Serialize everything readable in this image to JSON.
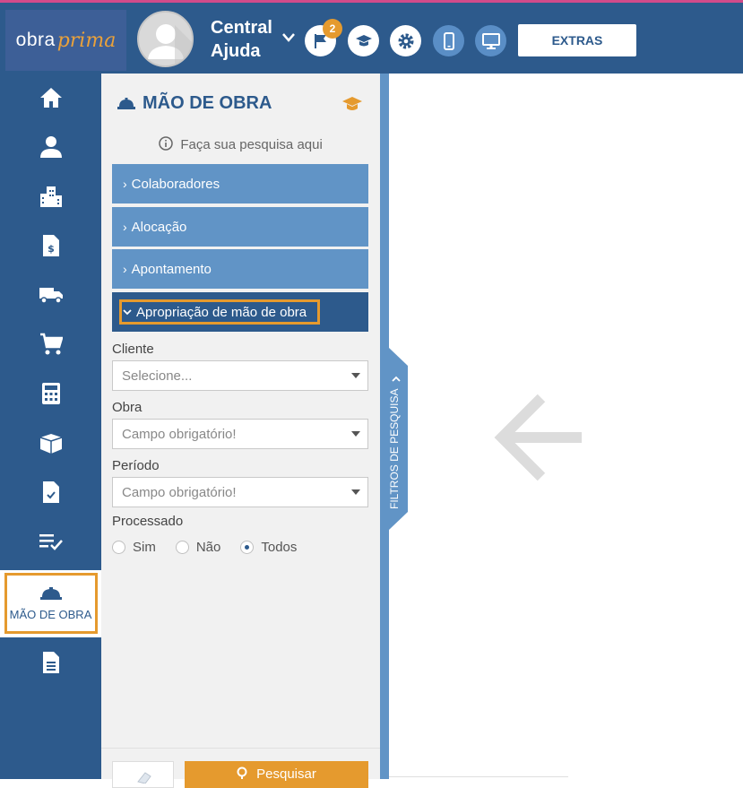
{
  "brand": {
    "logo_part1": "obra",
    "logo_part2": "prima"
  },
  "header": {
    "user_name_line1": "Central",
    "user_name_line2": "Ajuda",
    "notification_count": "2",
    "extras_label": "EXTRAS",
    "icons": [
      "flag-icon",
      "graduation-cap-icon",
      "gear-icon",
      "mobile-icon",
      "desktop-icon"
    ]
  },
  "sidebar": {
    "items": [
      {
        "icon": "home-icon"
      },
      {
        "icon": "user-icon"
      },
      {
        "icon": "building-icon"
      },
      {
        "icon": "invoice-icon"
      },
      {
        "icon": "truck-icon"
      },
      {
        "icon": "cart-icon"
      },
      {
        "icon": "calculator-icon"
      },
      {
        "icon": "box-icon"
      },
      {
        "icon": "document-check-icon"
      },
      {
        "icon": "checklist-icon"
      },
      {
        "icon": "hard-hat-icon",
        "label": "MÃO DE OBRA",
        "active": true
      },
      {
        "icon": "file-text-icon"
      }
    ]
  },
  "panel": {
    "title": "MÃO DE OBRA",
    "hint": "Faça sua pesquisa aqui",
    "accordions": [
      {
        "label": "Colaboradores"
      },
      {
        "label": "Alocação"
      },
      {
        "label": "Apontamento"
      },
      {
        "label": "Apropriação de mão de obra",
        "expanded": true
      }
    ],
    "form": {
      "cliente_label": "Cliente",
      "cliente_placeholder": "Selecione...",
      "obra_label": "Obra",
      "obra_placeholder": "Campo obrigatório!",
      "periodo_label": "Período",
      "periodo_placeholder": "Campo obrigatório!",
      "processado_label": "Processado",
      "options": [
        "Sim",
        "Não",
        "Todos"
      ],
      "selected": "Todos"
    },
    "search_label": "Pesquisar"
  },
  "filter_tab_label": "FILTROS DE PESQUISA",
  "colors": {
    "primary": "#2d5a8c",
    "accent": "#e59a2e",
    "light_blue": "#6194c6"
  }
}
